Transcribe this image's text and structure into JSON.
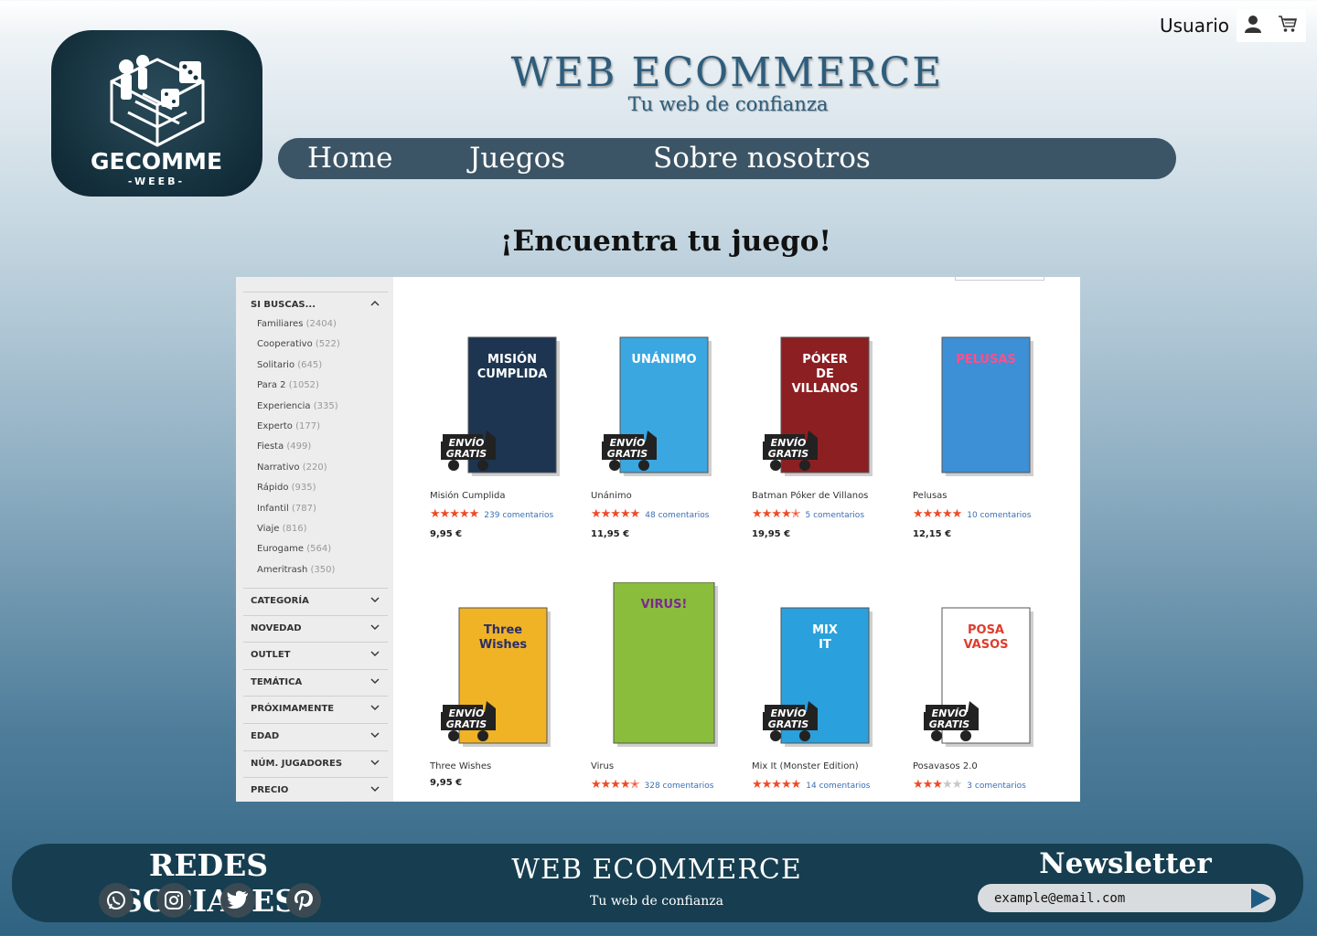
{
  "header": {
    "user_label": "Usuario",
    "user_icon": "user-icon",
    "cart_icon": "cart-icon",
    "logo_text": "GECOMME",
    "logo_subtext": "-WEEB-",
    "brand_title": "WEB ECOMMERCE",
    "brand_subtitle": "Tu web de confianza"
  },
  "nav": {
    "items": [
      {
        "label": "Home"
      },
      {
        "label": "Juegos"
      },
      {
        "label": "Sobre nosotros"
      }
    ]
  },
  "main": {
    "heading": "¡Encuentra tu juego!"
  },
  "sidebar": {
    "si_buscas": {
      "label": "SI BUSCAS...",
      "items": [
        {
          "name": "Familiares",
          "count": "(2404)"
        },
        {
          "name": "Cooperativo",
          "count": "(522)"
        },
        {
          "name": "Solitario",
          "count": "(645)"
        },
        {
          "name": "Para 2",
          "count": "(1052)"
        },
        {
          "name": "Experiencia",
          "count": "(335)"
        },
        {
          "name": "Experto",
          "count": "(177)"
        },
        {
          "name": "Fiesta",
          "count": "(499)"
        },
        {
          "name": "Narrativo",
          "count": "(220)"
        },
        {
          "name": "Rápido",
          "count": "(935)"
        },
        {
          "name": "Infantil",
          "count": "(787)"
        },
        {
          "name": "Viaje",
          "count": "(816)"
        },
        {
          "name": "Eurogame",
          "count": "(564)"
        },
        {
          "name": "Ameritrash",
          "count": "(350)"
        }
      ]
    },
    "sections": [
      {
        "label": "CATEGORÍA"
      },
      {
        "label": "NOVEDAD"
      },
      {
        "label": "OUTLET"
      },
      {
        "label": "TEMÁTICA"
      },
      {
        "label": "PRÓXIMAMENTE"
      },
      {
        "label": "EDAD"
      },
      {
        "label": "NÚM. JUGADORES"
      },
      {
        "label": "PRECIO"
      }
    ]
  },
  "products": [
    {
      "name": "Misión Cumplida",
      "rating": 5,
      "comments": "239  comentarios",
      "price": "9,95 €",
      "badge": "ENVÍO GRATIS",
      "color": "#1d3550",
      "accent": "#ffffff",
      "title": "MISIÓN CUMPLIDA"
    },
    {
      "name": "Unánimo",
      "rating": 5,
      "comments": "48  comentarios",
      "price": "11,95 €",
      "badge": "ENVÍO GRATIS",
      "color": "#3ba7e0",
      "accent": "#ffffff",
      "title": "UNÁNIMO"
    },
    {
      "name": "Batman Póker de Villanos",
      "rating": 4.5,
      "comments": "5  comentarios",
      "price": "19,95 €",
      "badge": "ENVÍO GRATIS",
      "color": "#8c1f22",
      "accent": "#ffffff",
      "title": "PÓKER DE VILLANOS"
    },
    {
      "name": "Pelusas",
      "rating": 5,
      "comments": "10  comentarios",
      "price": "12,15 €",
      "badge": "",
      "color": "#3d8fd6",
      "accent": "#ff4f8a",
      "title": "PELUSAS"
    },
    {
      "name": "Three Wishes",
      "rating": 0,
      "comments": "",
      "price": "9,95 €",
      "badge": "ENVÍO GRATIS",
      "color": "#f0b325",
      "accent": "#2a2d6b",
      "title": "Three Wishes"
    },
    {
      "name": "Virus",
      "rating": 4.5,
      "comments": "328  comentarios",
      "price": "",
      "badge": "",
      "color": "#8bbd3d",
      "accent": "#7a2a8f",
      "title": "VIRUS!"
    },
    {
      "name": "Mix It (Monster Edition)",
      "rating": 5,
      "comments": "14  comentarios",
      "price": "",
      "badge": "ENVÍO GRATIS",
      "color": "#2aa0dc",
      "accent": "#ffffff",
      "title": "MIX IT"
    },
    {
      "name": "Posavasos 2.0",
      "rating": 3,
      "comments": "3  comentarios",
      "price": "",
      "badge": "ENVÍO GRATIS",
      "color": "#ffffff",
      "accent": "#e03c2c",
      "title": "POSA VASOS"
    }
  ],
  "footer": {
    "social_title": "REDES SOCIALES",
    "social_icons": [
      "whatsapp-icon",
      "instagram-icon",
      "twitter-icon",
      "pinterest-icon"
    ],
    "brand_title": "WEB ECOMMERCE",
    "brand_subtitle": "Tu web de confianza",
    "newsletter_title": "Newsletter",
    "newsletter_value": "example@email.com",
    "send_icon": "send-arrow-icon"
  }
}
